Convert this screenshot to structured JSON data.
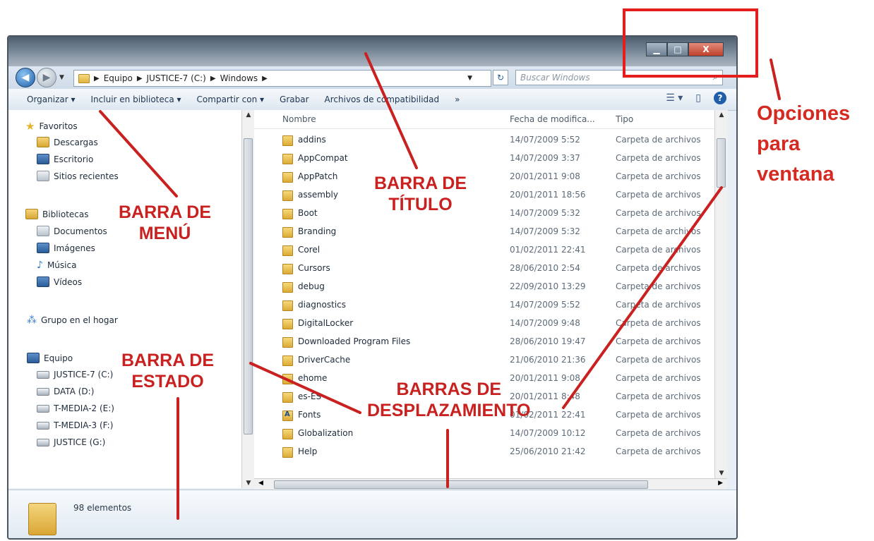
{
  "window": {
    "caption_buttons": {
      "minimize_icon": "minimize-icon",
      "maximize_icon": "maximize-icon",
      "close_label": "X"
    }
  },
  "address": {
    "crumbs": [
      "Equipo",
      "JUSTICE-7 (C:)",
      "Windows"
    ],
    "search_placeholder": "Buscar Windows"
  },
  "toolbar": {
    "items": [
      "Organizar ▾",
      "Incluir en biblioteca ▾",
      "Compartir con ▾",
      "Grabar",
      "Archivos de compatibilidad",
      "»"
    ]
  },
  "navpane": {
    "favorites": {
      "label": "Favoritos",
      "items": [
        "Descargas",
        "Escritorio",
        "Sitios recientes"
      ]
    },
    "libraries": {
      "label": "Bibliotecas",
      "items": [
        "Documentos",
        "Imágenes",
        "Música",
        "Vídeos"
      ]
    },
    "homegroup": {
      "label": "Grupo en el hogar"
    },
    "computer": {
      "label": "Equipo",
      "items": [
        "JUSTICE-7 (C:)",
        "DATA (D:)",
        "T-MEDIA-2 (E:)",
        "T-MEDIA-3 (F:)",
        "JUSTICE (G:)"
      ]
    }
  },
  "columns": {
    "name": "Nombre",
    "date": "Fecha de modifica...",
    "type": "Tipo"
  },
  "files": [
    {
      "name": "addins",
      "date": "14/07/2009 5:52",
      "type": "Carpeta de archivos"
    },
    {
      "name": "AppCompat",
      "date": "14/07/2009 3:37",
      "type": "Carpeta de archivos"
    },
    {
      "name": "AppPatch",
      "date": "20/01/2011 9:08",
      "type": "Carpeta de archivos"
    },
    {
      "name": "assembly",
      "date": "20/01/2011 18:56",
      "type": "Carpeta de archivos"
    },
    {
      "name": "Boot",
      "date": "14/07/2009 5:32",
      "type": "Carpeta de archivos"
    },
    {
      "name": "Branding",
      "date": "14/07/2009 5:32",
      "type": "Carpeta de archivos"
    },
    {
      "name": "Corel",
      "date": "01/02/2011 22:41",
      "type": "Carpeta de archivos"
    },
    {
      "name": "Cursors",
      "date": "28/06/2010 2:54",
      "type": "Carpeta de archivos"
    },
    {
      "name": "debug",
      "date": "22/09/2010 13:29",
      "type": "Carpeta de archivos"
    },
    {
      "name": "diagnostics",
      "date": "14/07/2009 5:52",
      "type": "Carpeta de archivos"
    },
    {
      "name": "DigitalLocker",
      "date": "14/07/2009 9:48",
      "type": "Carpeta de archivos"
    },
    {
      "name": "Downloaded Program Files",
      "date": "28/06/2010 19:47",
      "type": "Carpeta de archivos"
    },
    {
      "name": "DriverCache",
      "date": "21/06/2010 21:36",
      "type": "Carpeta de archivos"
    },
    {
      "name": "ehome",
      "date": "20/01/2011 9:08",
      "type": "Carpeta de archivos"
    },
    {
      "name": "es-ES",
      "date": "20/01/2011 8:48",
      "type": "Carpeta de archivos"
    },
    {
      "name": "Fonts",
      "date": "01/02/2011 22:41",
      "type": "Carpeta de archivos"
    },
    {
      "name": "Globalization",
      "date": "14/07/2009 10:12",
      "type": "Carpeta de archivos"
    },
    {
      "name": "Help",
      "date": "25/06/2010 21:42",
      "type": "Carpeta de archivos"
    }
  ],
  "status": {
    "count": "98 elementos"
  },
  "annotations": {
    "menu": [
      "BARRA DE",
      "MENÚ"
    ],
    "title": [
      "BARRA DE",
      "TÍTULO"
    ],
    "status": [
      "BARRA DE",
      "ESTADO"
    ],
    "scroll": [
      "BARRAS DE",
      "DESPLAZAMIENTO"
    ],
    "options": [
      "Opciones",
      "para",
      "ventana"
    ],
    "color": "#c8211f"
  }
}
